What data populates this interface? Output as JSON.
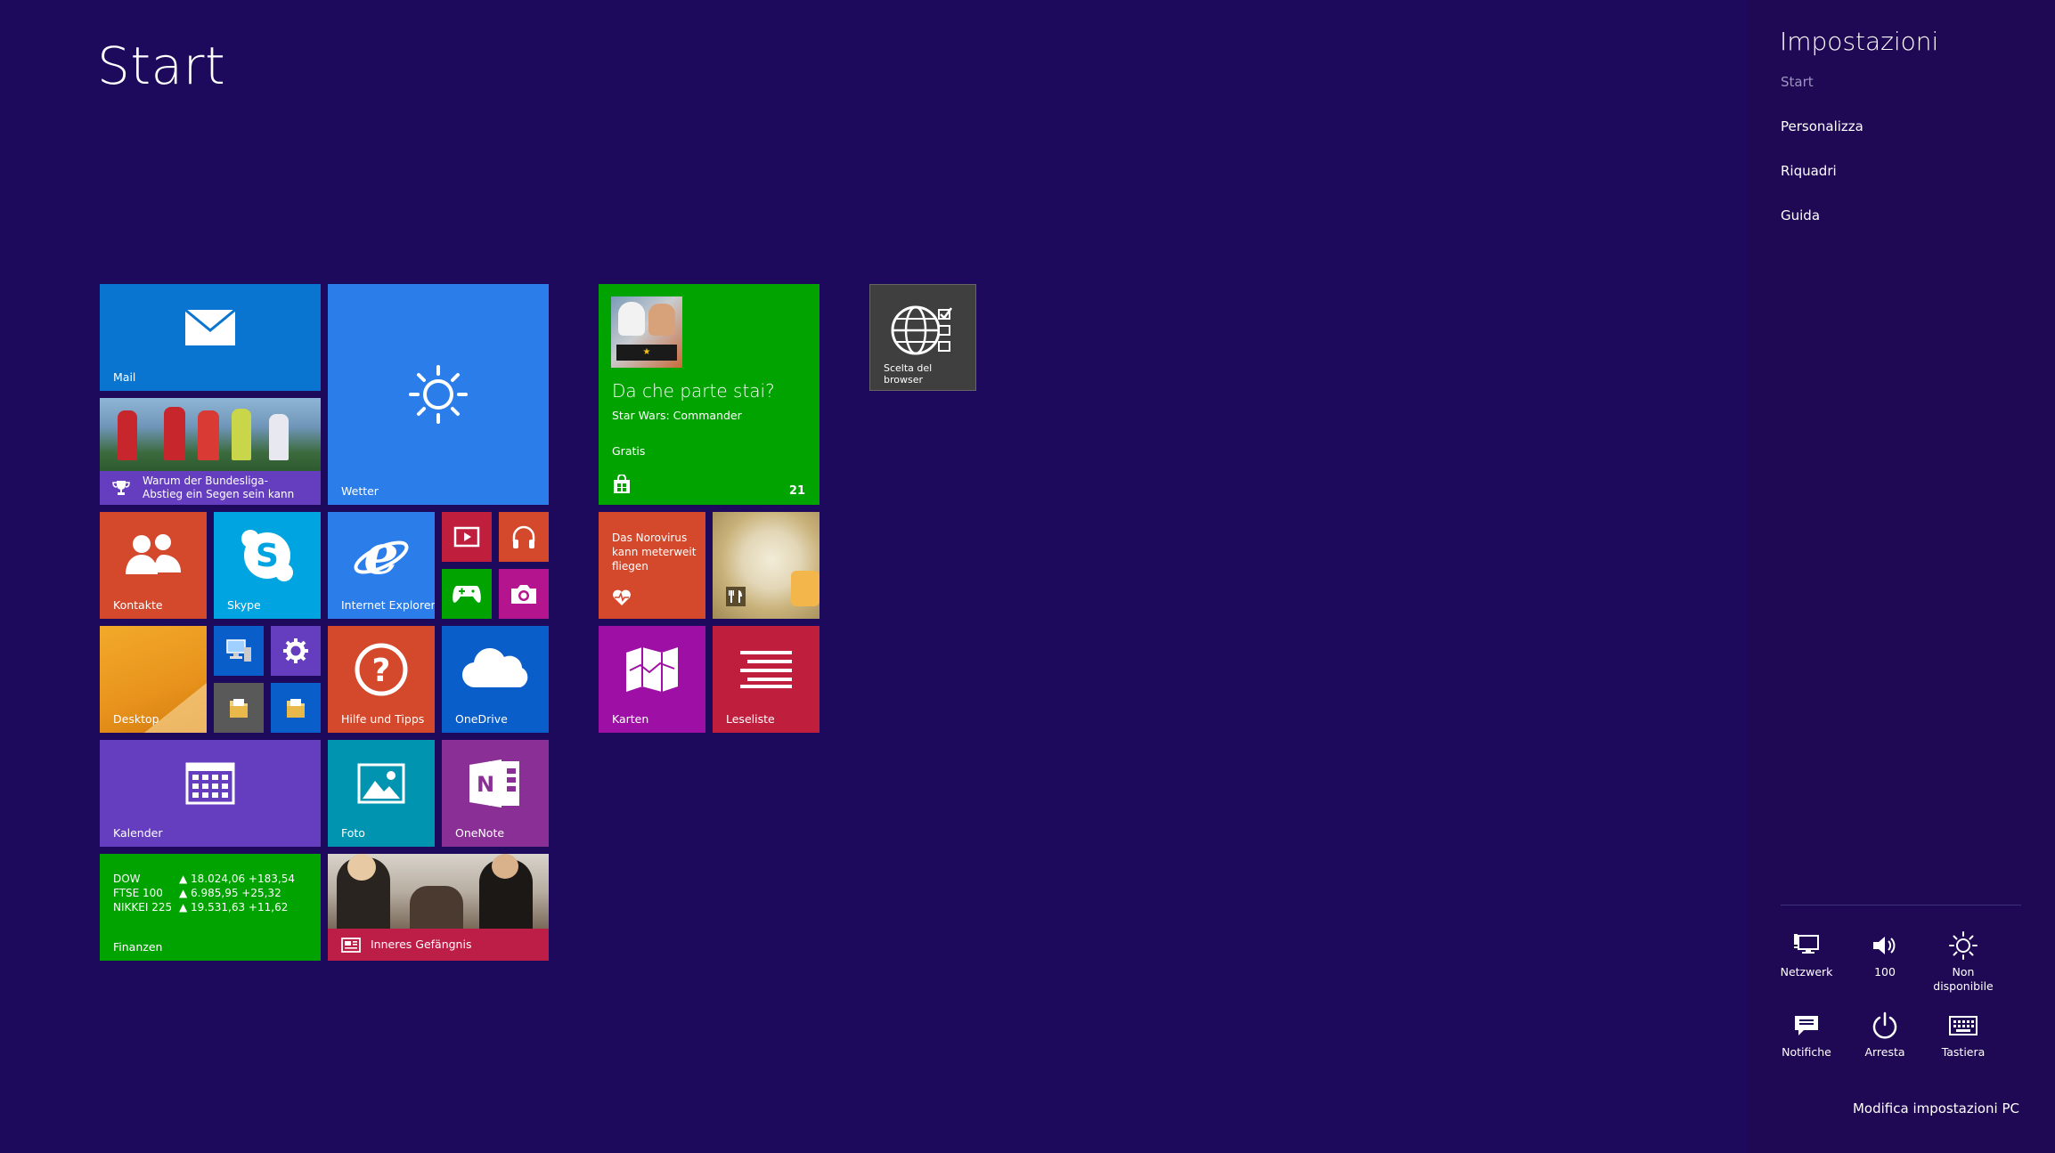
{
  "start": {
    "title": "Start"
  },
  "tiles": {
    "mail": {
      "label": "Mail"
    },
    "news_sport": {
      "headline": "Warum der Bundesliga-Abstieg ein Segen sein kann"
    },
    "weather": {
      "label": "Wetter"
    },
    "starwars": {
      "heading": "Da che parte stai?",
      "subtitle": "Star Wars: Commander",
      "price": "Gratis",
      "count": "21"
    },
    "browser_choice": {
      "label": "Scelta del browser"
    },
    "contacts": {
      "label": "Kontakte"
    },
    "skype": {
      "label": "Skype"
    },
    "ie": {
      "label": "Internet Explorer"
    },
    "health": {
      "headline": "Das Norovirus kann meterweit fliegen"
    },
    "desktop": {
      "label": "Desktop"
    },
    "help": {
      "label": "Hilfe und Tipps"
    },
    "onedrive": {
      "label": "OneDrive"
    },
    "maps": {
      "label": "Karten"
    },
    "readinglist": {
      "label": "Leseliste"
    },
    "calendar": {
      "label": "Kalender"
    },
    "photos": {
      "label": "Foto"
    },
    "onenote": {
      "label": "OneNote"
    },
    "finance": {
      "label": "Finanzen",
      "rows": [
        {
          "index": "DOW",
          "value": "▲ 18.024,06 +183,54"
        },
        {
          "index": "FTSE 100",
          "value": "▲ 6.985,95 +25,32"
        },
        {
          "index": "NIKKEI 225",
          "value": "▲ 19.531,63 +11,62"
        }
      ]
    },
    "news_main": {
      "headline": "Inneres Gefängnis"
    }
  },
  "charms": {
    "title": "Impostazioni",
    "items": [
      "Start",
      "Personalizza",
      "Riquadri",
      "Guida"
    ],
    "quick_settings": [
      {
        "icon": "network-icon",
        "label": "Netzwerk"
      },
      {
        "icon": "volume-icon",
        "label": "100"
      },
      {
        "icon": "brightness-icon",
        "label": "Non disponibile"
      },
      {
        "icon": "notifications-icon",
        "label": "Notifiche"
      },
      {
        "icon": "power-icon",
        "label": "Arresta"
      },
      {
        "icon": "keyboard-icon",
        "label": "Tastiera"
      }
    ],
    "bottom_link": "Modifica impostazioni PC"
  },
  "colors": {
    "background": "#1d0a5c",
    "mail": "#0a74d1",
    "weather": "#2b7de9",
    "store": "#00a300",
    "contacts": "#d4482b",
    "skype": "#00a4e0",
    "ie": "#2b7de9",
    "help": "#d4482b",
    "onedrive": "#0a5ec9",
    "maps": "#9e0fa5",
    "readinglist": "#c01e3d",
    "calendar": "#643ebf",
    "photos": "#0094b1",
    "onenote": "#8a2f96",
    "finance": "#00a300",
    "news": "#bd1e47"
  }
}
